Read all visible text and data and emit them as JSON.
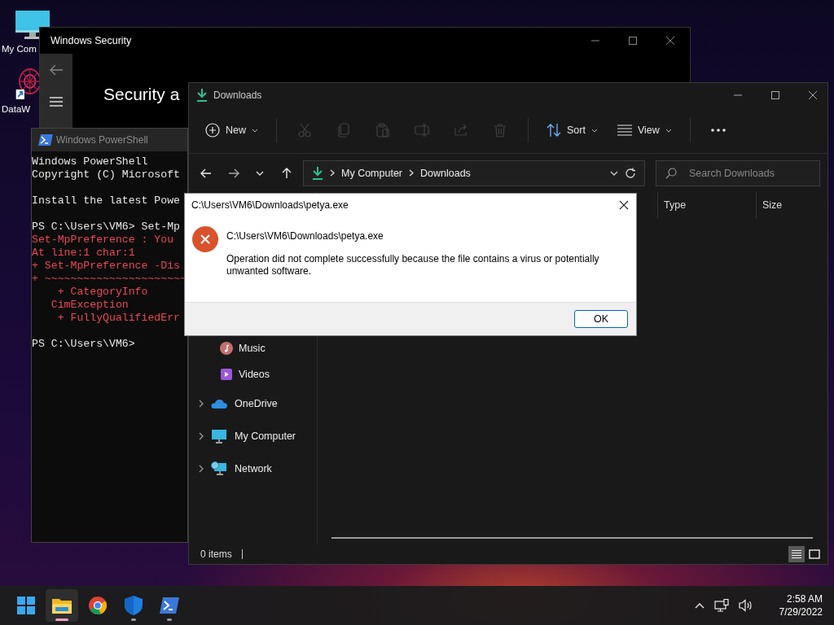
{
  "desktop": {
    "icons": [
      {
        "label": "My Com",
        "kind": "computer"
      },
      {
        "label": "DataW",
        "kind": "shortcut"
      }
    ]
  },
  "security_window": {
    "title": "Windows Security",
    "heading": "Security a"
  },
  "powershell": {
    "title": "Windows PowerShell",
    "lines": [
      {
        "kind": "output",
        "text": "Windows PowerShell"
      },
      {
        "kind": "output",
        "text": "Copyright (C) Microsoft"
      },
      {
        "kind": "blank"
      },
      {
        "kind": "output",
        "text": "Install the latest Powe"
      },
      {
        "kind": "blank"
      },
      {
        "kind": "output",
        "text": "PS C:\\Users\\VM6> Set-Mp"
      },
      {
        "kind": "error",
        "text": "Set-MpPreference : You"
      },
      {
        "kind": "error",
        "text": "At line:1 char:1"
      },
      {
        "kind": "error",
        "text": "+ Set-MpPreference -Dis"
      },
      {
        "kind": "error",
        "text": "+ ~~~~~~~~~~~~~~~~~~~~~~"
      },
      {
        "kind": "error",
        "text": "    + CategoryInfo"
      },
      {
        "kind": "error",
        "text": "   CimException"
      },
      {
        "kind": "error",
        "text": "    + FullyQualifiedErr"
      },
      {
        "kind": "blank"
      },
      {
        "kind": "output",
        "text": "PS C:\\Users\\VM6>"
      }
    ]
  },
  "explorer": {
    "title": "Downloads",
    "toolbar": [
      {
        "kind": "new",
        "label": "New",
        "disabled": false
      },
      {
        "kind": "cut",
        "disabled": true
      },
      {
        "kind": "copy",
        "disabled": true
      },
      {
        "kind": "paste",
        "disabled": true
      },
      {
        "kind": "rename",
        "disabled": true
      },
      {
        "kind": "share",
        "disabled": true
      },
      {
        "kind": "delete",
        "disabled": true
      },
      {
        "kind": "sort",
        "label": "Sort",
        "disabled": false
      },
      {
        "kind": "view",
        "label": "View",
        "disabled": false
      },
      {
        "kind": "more",
        "disabled": false
      }
    ],
    "address": {
      "path": [
        "My Computer",
        "Downloads"
      ]
    },
    "search": {
      "placeholder": "Search Downloads"
    },
    "columns": [
      "Type",
      "Size"
    ],
    "sidebar": [
      {
        "kind": "music",
        "label": "Music"
      },
      {
        "kind": "videos",
        "label": "Videos"
      },
      {
        "kind": "onedrive",
        "label": "OneDrive",
        "expanded": false
      },
      {
        "kind": "computer",
        "label": "My Computer",
        "expanded": false
      },
      {
        "kind": "network",
        "label": "Network",
        "expanded": false
      }
    ],
    "status": "0 items",
    "views": [
      {
        "kind": "details",
        "selected": true
      },
      {
        "kind": "tiles",
        "selected": false
      }
    ]
  },
  "dialog": {
    "title": "C:\\Users\\VM6\\Downloads\\petya.exe",
    "heading": "C:\\Users\\VM6\\Downloads\\petya.exe",
    "message": "Operation did not complete successfully because the file contains a virus or potentially unwanted software.",
    "buttons": [
      {
        "label": "OK",
        "default": true
      }
    ]
  },
  "taskbar": {
    "apps": [
      {
        "kind": "start",
        "active": false,
        "running": false
      },
      {
        "kind": "explorer",
        "active": true,
        "running": true
      },
      {
        "kind": "chrome",
        "active": false,
        "running": false
      },
      {
        "kind": "security",
        "active": false,
        "running": true
      },
      {
        "kind": "powershell",
        "active": false,
        "running": true
      }
    ],
    "time": "2:58 AM",
    "date": "7/29/2022"
  }
}
